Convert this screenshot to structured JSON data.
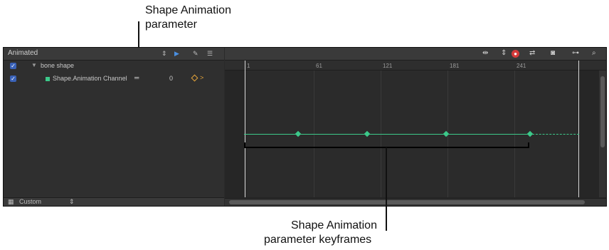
{
  "callouts": {
    "top": [
      "Shape Animation",
      "parameter"
    ],
    "bottom": [
      "Shape Animation",
      "parameter keyframes"
    ]
  },
  "panel": {
    "title": "Animated",
    "rows": [
      {
        "label": "bone shape",
        "checked": true
      },
      {
        "label": "Shape.Animation Channel",
        "value": "0",
        "checked": true
      }
    ],
    "footer_preset": "Custom"
  },
  "timeline": {
    "ruler_ticks": [
      "1",
      "61",
      "121",
      "181",
      "241"
    ],
    "keyframe_count": 4
  },
  "colors": {
    "curve": "#3cc98a",
    "keyframe_marker": "#e4a43a",
    "checkbox": "#3a62b8",
    "record": "#d43a3a"
  }
}
